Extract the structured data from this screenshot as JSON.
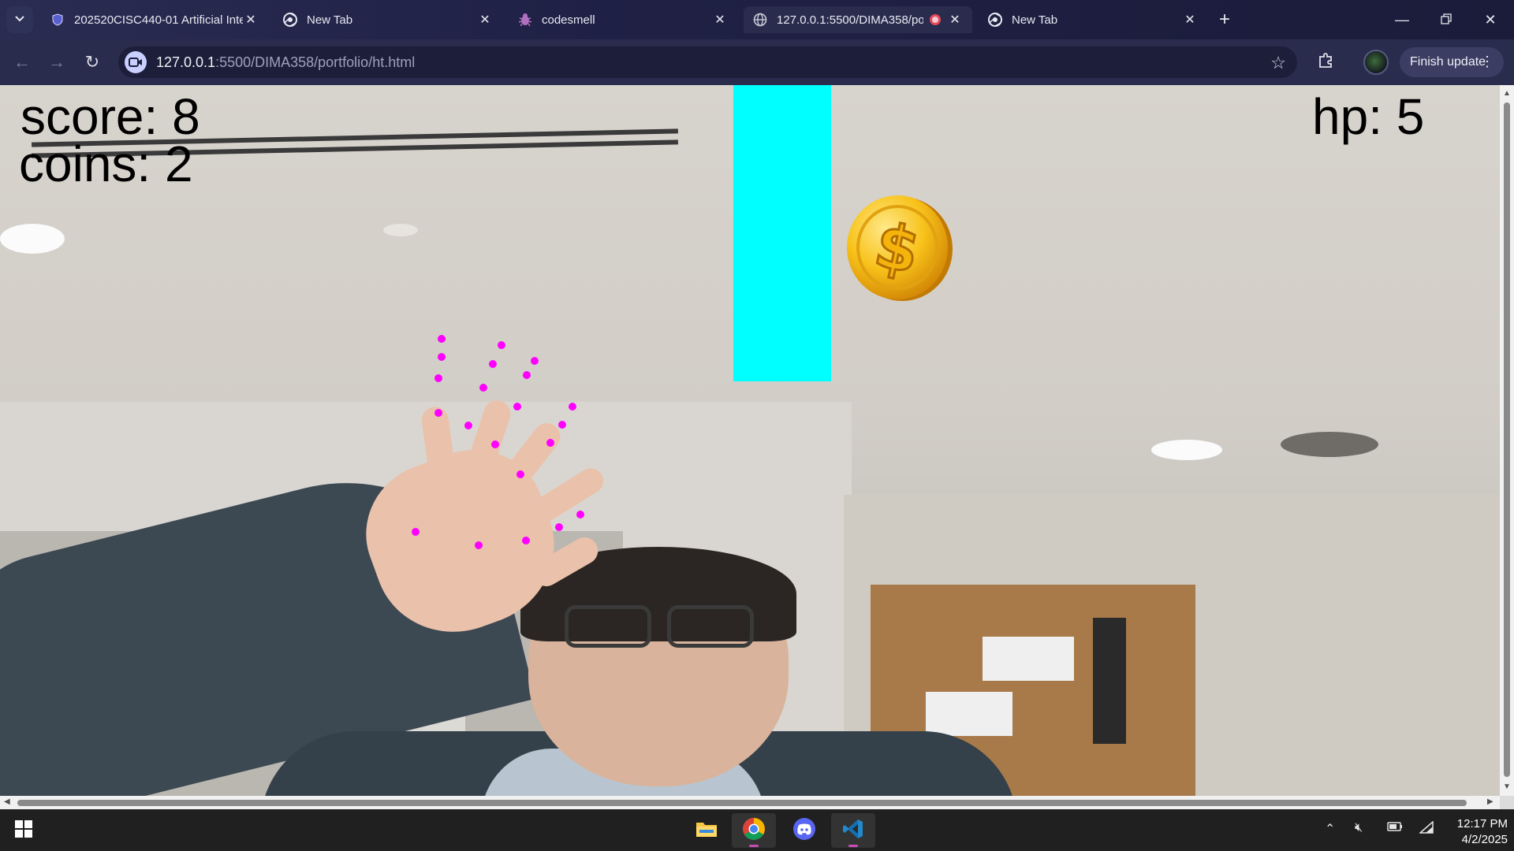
{
  "browser": {
    "tabs": [
      {
        "title": "202520CISC440-01 Artificial Inte",
        "icon": "course-shield-icon",
        "active": false
      },
      {
        "title": "New Tab",
        "icon": "chrome-icon",
        "active": false
      },
      {
        "title": "codesmell",
        "icon": "bug-icon",
        "active": false
      },
      {
        "title": "127.0.0.1:5500/DIMA358/po",
        "icon": "globe-icon",
        "active": true,
        "recording": true
      },
      {
        "title": "New Tab",
        "icon": "chrome-icon",
        "active": false
      }
    ],
    "url_host": "127.0.0.1",
    "url_path": ":5500/DIMA358/portfolio/ht.html",
    "finish_update_label": "Finish update"
  },
  "game": {
    "score_text": "score: 8",
    "coins_text": "coins: 2",
    "hp_text": "hp: 5",
    "pipe_color": "#00ffff",
    "landmark_color": "#ff00ff",
    "coin_symbol": "$"
  },
  "taskbar": {
    "apps": [
      "file-explorer-icon",
      "chrome-icon",
      "discord-icon",
      "vscode-icon"
    ],
    "clock_time": "12:17 PM",
    "clock_date": "4/2/2025"
  }
}
